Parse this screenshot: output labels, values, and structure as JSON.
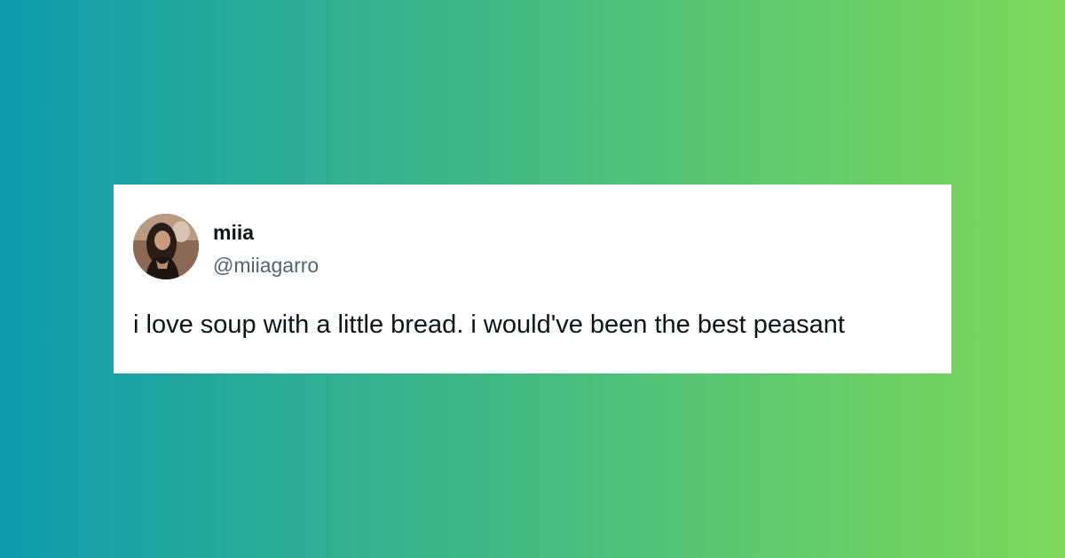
{
  "tweet": {
    "display_name": "miia",
    "handle": "@miiagarro",
    "text": "i love soup with a little bread. i would've been the best peasant"
  }
}
